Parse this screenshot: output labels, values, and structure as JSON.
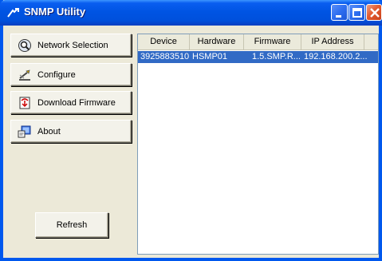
{
  "window": {
    "title": "SNMP Utility"
  },
  "nav": {
    "items": [
      {
        "label": "Network Selection",
        "icon": "network-search-icon"
      },
      {
        "label": "Configure",
        "icon": "configure-icon"
      },
      {
        "label": "Download Firmware",
        "icon": "download-firmware-icon"
      },
      {
        "label": "About",
        "icon": "about-icon"
      }
    ],
    "refresh_label": "Refresh"
  },
  "devices": {
    "columns": [
      "Device",
      "Hardware",
      "Firmware",
      "IP Address"
    ],
    "rows": [
      {
        "device": "3925883510",
        "hardware": "HSMP01",
        "firmware": "1.5.SMP.R...",
        "ip": "192.168.200.2...",
        "selected": true
      }
    ]
  },
  "colors": {
    "titlebar": "#0054e3",
    "selection": "#316ac5",
    "window_bg": "#ece9d8",
    "close_button": "#e35b30"
  }
}
